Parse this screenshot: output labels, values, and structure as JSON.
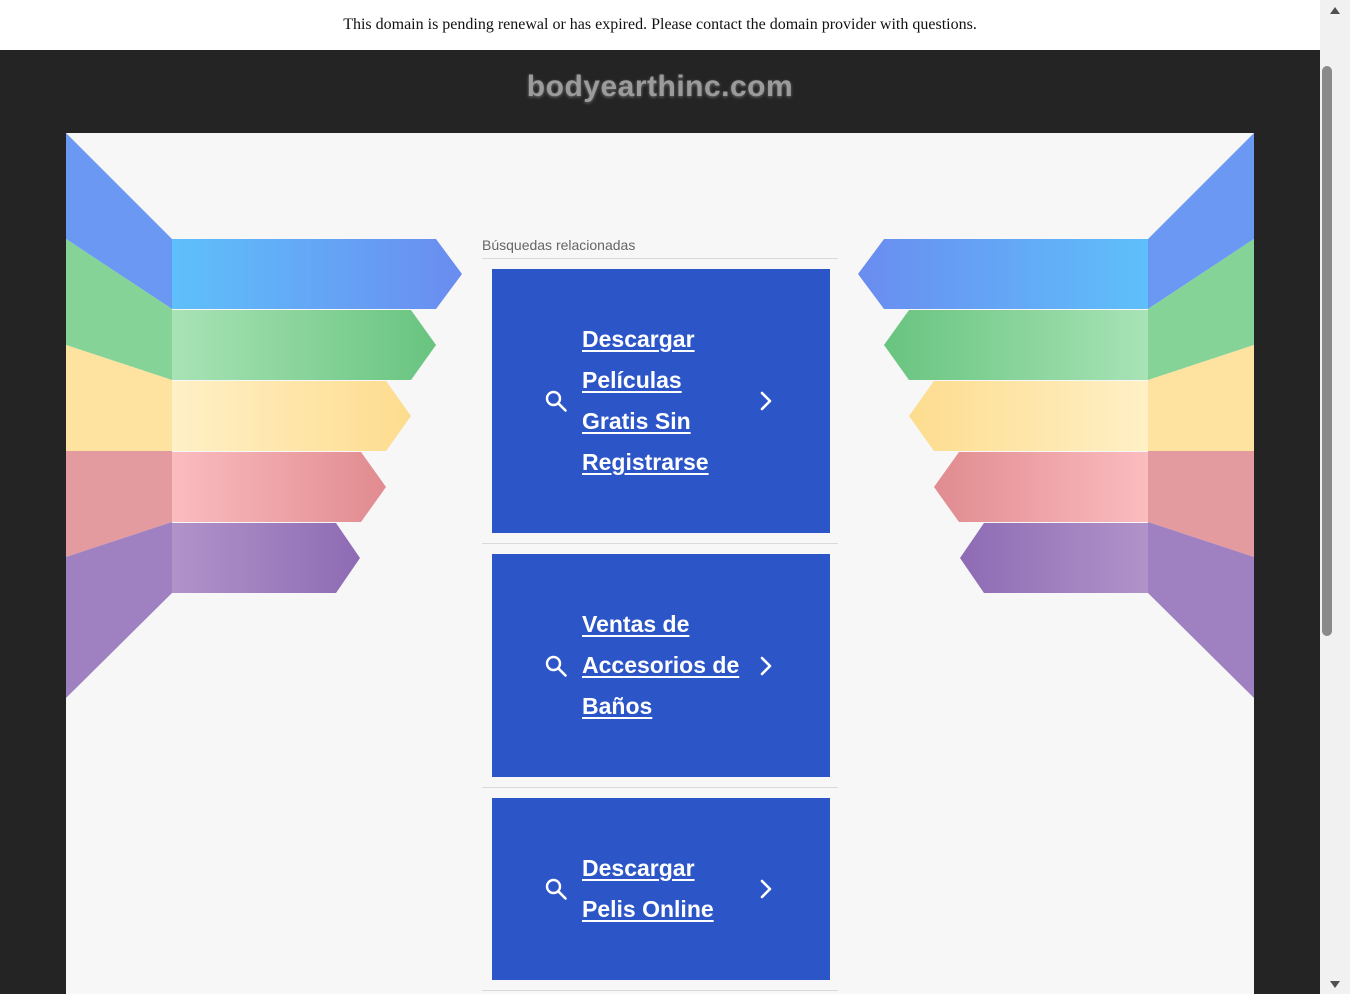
{
  "notice": {
    "text": "This domain is pending renewal or has expired. Please contact the domain provider with questions."
  },
  "header": {
    "domain": "bodyearthinc.com"
  },
  "related_searches": {
    "heading": "Búsquedas relacionadas",
    "items": [
      {
        "label": "Descargar Películas Gratis Sin Registrarse",
        "icon": "search-icon",
        "arrow": "chevron-right-icon"
      },
      {
        "label": "Ventas de Accesorios de Baños",
        "icon": "search-icon",
        "arrow": "chevron-right-icon"
      },
      {
        "label": "Descargar Pelis Online",
        "icon": "search-icon",
        "arrow": "chevron-right-icon"
      }
    ]
  },
  "colors": {
    "card_background": "#2c55c8",
    "page_background": "#242424",
    "panel_background": "#f7f7f7",
    "band_blue": "#5f9cf2",
    "band_green": "#7fcf8f",
    "band_yellow": "#fde3a0",
    "band_pink": "#f0a3a8",
    "band_purple": "#9f7fbf"
  }
}
